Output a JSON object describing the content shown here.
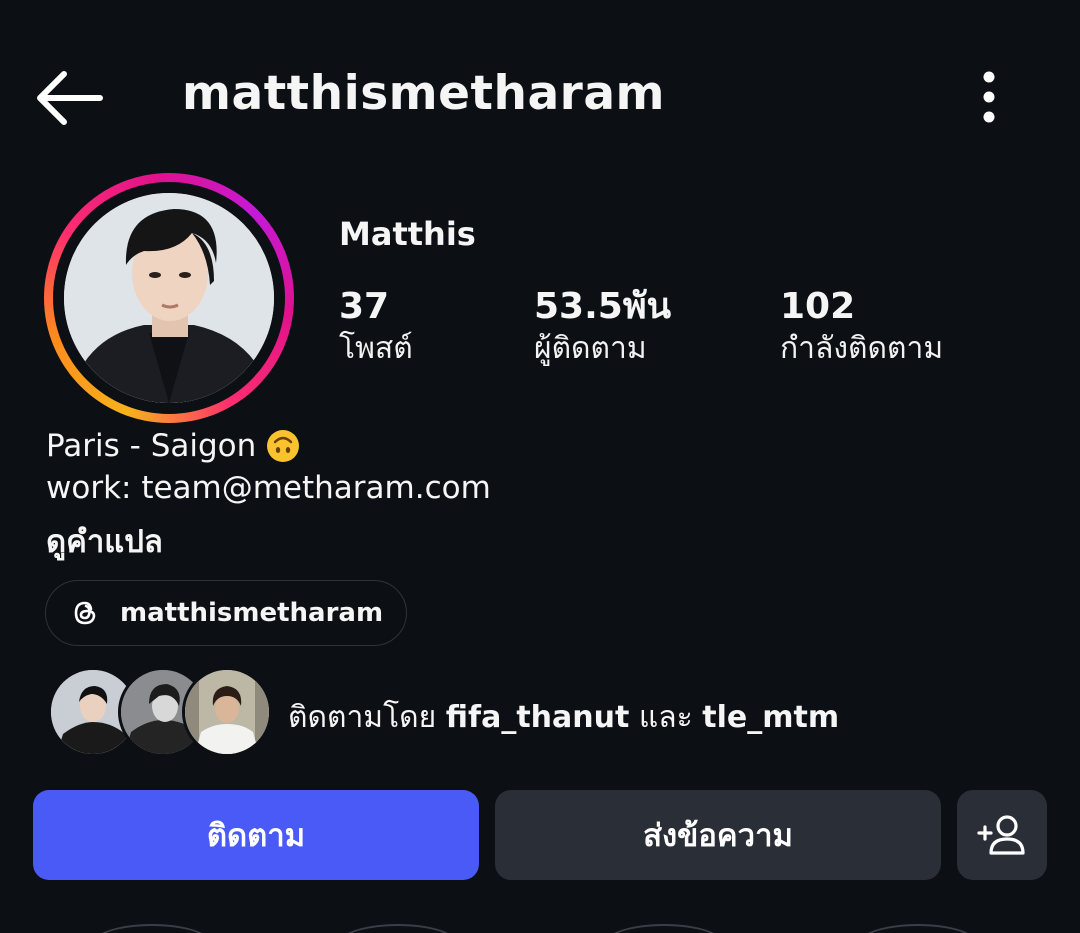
{
  "header": {
    "username": "matthismetharam",
    "back_icon": "arrow-left-icon",
    "more_icon": "more-vertical-icon"
  },
  "profile": {
    "display_name": "Matthis",
    "stats": [
      {
        "value": "37",
        "label": "โพสต์"
      },
      {
        "value": "53.5พัน",
        "label": "ผู้ติดตาม"
      },
      {
        "value": "102",
        "label": "กำลังติดตาม"
      }
    ],
    "bio": {
      "line1": "Paris - Saigon",
      "line2": "work: team@metharam.com",
      "translate_label": "ดูคำแปล"
    },
    "threads": {
      "icon": "threads-icon",
      "handle": "matthismetharam"
    },
    "followed_by": {
      "prefix": "ติดตามโดย",
      "user1": "fifa_thanut",
      "conjunction": "และ",
      "user2": "tle_mtm"
    }
  },
  "actions": {
    "follow_label": "ติดตาม",
    "message_label": "ส่งข้อความ",
    "add_user_icon": "add-user-icon"
  },
  "colors": {
    "background": "#0c0f14",
    "follow_button": "#4a5af7",
    "secondary_button": "#2a2e37",
    "story_ring_start": "#f7b21c",
    "story_ring_end": "#e0128c"
  }
}
